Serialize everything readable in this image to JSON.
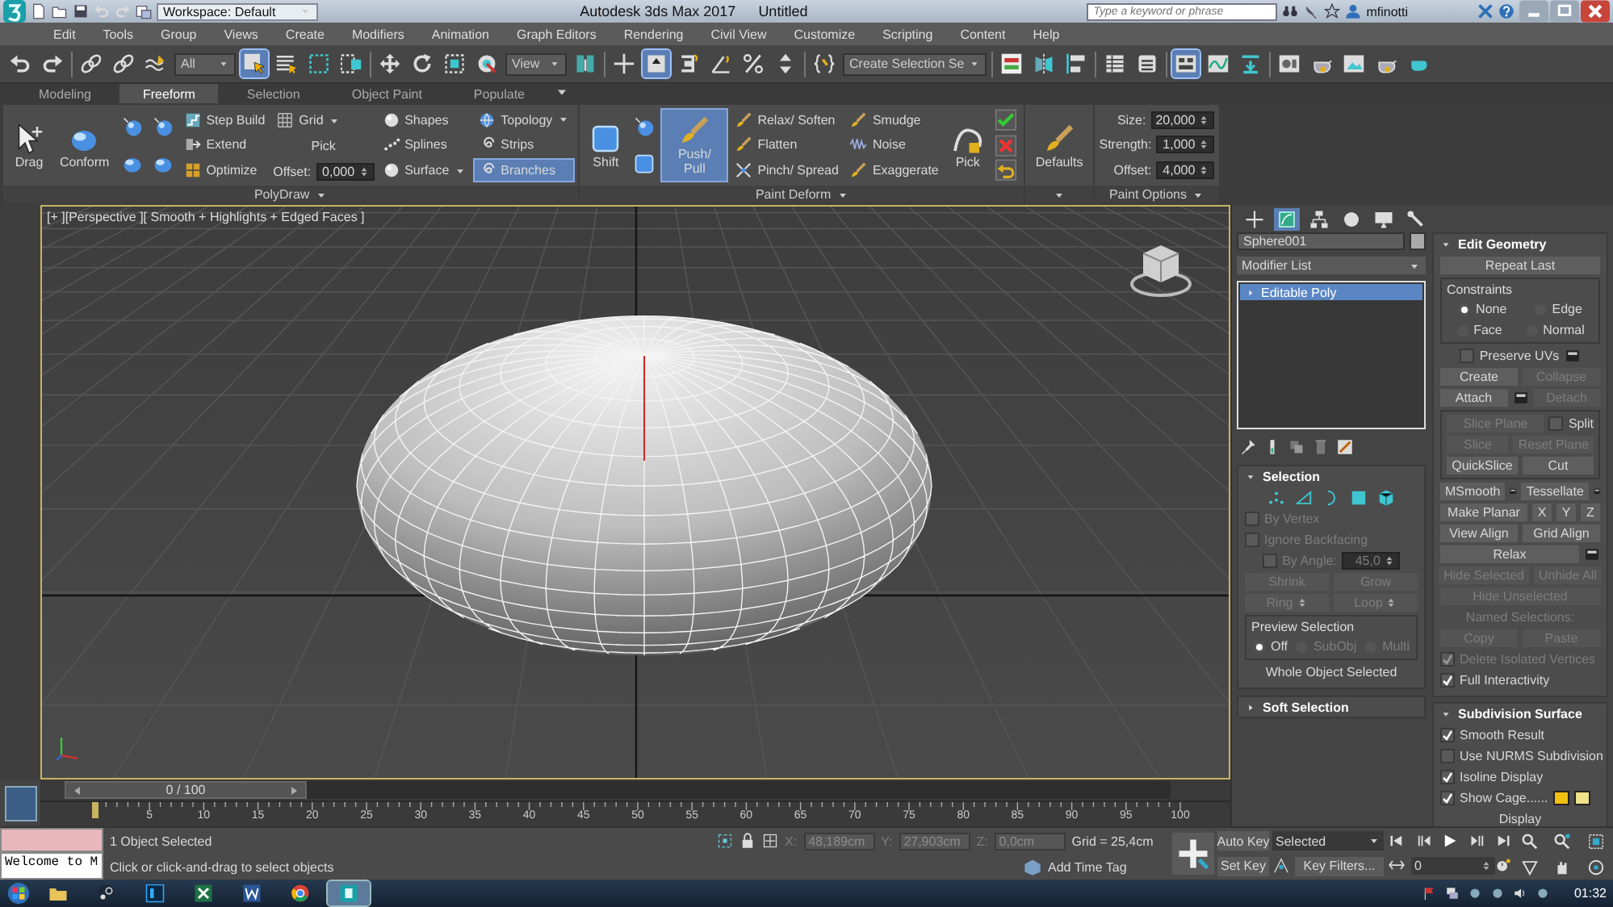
{
  "title_bar": {
    "workspace": "Workspace: Default",
    "title": "Autodesk 3ds Max 2017",
    "document": "Untitled",
    "search": {
      "placeholder": "Type a keyword or phrase"
    },
    "user": "mfinotti"
  },
  "menu": [
    "Edit",
    "Tools",
    "Group",
    "Views",
    "Create",
    "Modifiers",
    "Animation",
    "Graph Editors",
    "Rendering",
    "Civil View",
    "Customize",
    "Scripting",
    "Content",
    "Help"
  ],
  "toolbar": {
    "items": [
      {
        "kind": "button",
        "selected": false
      },
      {
        "kind": "button",
        "selected": false
      },
      {
        "kind": "separator"
      },
      {
        "kind": "button",
        "selected": false
      },
      {
        "kind": "button",
        "selected": false
      },
      {
        "kind": "button",
        "selected": false
      },
      {
        "kind": "dropdown",
        "value": "All"
      },
      {
        "kind": "button",
        "selected": true
      },
      {
        "kind": "button",
        "selected": false
      },
      {
        "kind": "button",
        "selected": false
      },
      {
        "kind": "button",
        "selected": false
      },
      {
        "kind": "separator"
      },
      {
        "kind": "button",
        "selected": false
      },
      {
        "kind": "button",
        "selected": false
      },
      {
        "kind": "button",
        "selected": false
      },
      {
        "kind": "button",
        "selected": false
      },
      {
        "kind": "dropdown",
        "value": "View"
      },
      {
        "kind": "button",
        "selected": false
      },
      {
        "kind": "separator"
      },
      {
        "kind": "button",
        "selected": false
      },
      {
        "kind": "button",
        "selected": true
      },
      {
        "kind": "button",
        "selected": false
      },
      {
        "kind": "button",
        "selected": false
      },
      {
        "kind": "button",
        "selected": false
      },
      {
        "kind": "button",
        "selected": false
      },
      {
        "kind": "separator"
      },
      {
        "kind": "button",
        "selected": false
      },
      {
        "kind": "dropdown",
        "value": "Create Selection Se"
      },
      {
        "kind": "separator"
      },
      {
        "kind": "button",
        "selected": false
      },
      {
        "kind": "button",
        "selected": false
      },
      {
        "kind": "button",
        "selected": false
      },
      {
        "kind": "separator"
      },
      {
        "kind": "button",
        "selected": false
      },
      {
        "kind": "button",
        "selected": false
      },
      {
        "kind": "separator"
      },
      {
        "kind": "button",
        "selected": true
      },
      {
        "kind": "button",
        "selected": false
      },
      {
        "kind": "button",
        "selected": false
      },
      {
        "kind": "separator"
      },
      {
        "kind": "button",
        "selected": false
      },
      {
        "kind": "button",
        "selected": false
      },
      {
        "kind": "button",
        "selected": false
      },
      {
        "kind": "button",
        "selected": false
      },
      {
        "kind": "button",
        "selected": false
      }
    ]
  },
  "ribbon_tabs": [
    {
      "label": "Modeling",
      "selected": false
    },
    {
      "label": "Freeform",
      "selected": true
    },
    {
      "label": "Selection",
      "selected": false
    },
    {
      "label": "Object Paint",
      "selected": false
    },
    {
      "label": "Populate",
      "selected": false
    }
  ],
  "ribbon": {
    "groups": [
      {
        "title": "PolyDraw",
        "columns": [
          [
            {
              "kind": "big",
              "label": "Drag",
              "selected": false
            }
          ],
          [
            {
              "kind": "big",
              "label": "Conform",
              "selected": false
            }
          ],
          [
            {
              "kind": "icon",
              "selected": false
            },
            {
              "kind": "icon",
              "selected": false
            }
          ],
          [
            {
              "kind": "icon",
              "selected": false
            },
            {
              "kind": "icon",
              "selected": false
            }
          ],
          [
            {
              "kind": "small",
              "label": "Step Build",
              "selected": false
            },
            {
              "kind": "small",
              "label": "Extend",
              "selected": false
            },
            {
              "kind": "small",
              "label": "Optimize",
              "selected": false
            }
          ],
          [
            {
              "kind": "dropdown",
              "label": "Grid",
              "selected": false
            },
            {
              "kind": "text",
              "label": "Pick",
              "selected": false
            },
            {
              "kind": "spinner",
              "label": "Offset:",
              "value": "0,000"
            }
          ],
          [
            {
              "kind": "small",
              "label": "Shapes",
              "selected": false
            },
            {
              "kind": "small",
              "label": "Splines",
              "selected": false
            },
            {
              "kind": "small-dropdown",
              "label": "Surface",
              "selected": false
            }
          ],
          [
            {
              "kind": "small-dropdown",
              "label": "Topology",
              "selected": false
            },
            {
              "kind": "small",
              "label": "Strips",
              "selected": false
            },
            {
              "kind": "small",
              "label": "Branches",
              "selected": true
            }
          ]
        ]
      },
      {
        "title": "Paint Deform",
        "columns": [
          [
            {
              "kind": "big",
              "label": "Shift",
              "selected": false
            }
          ],
          [
            {
              "kind": "icon",
              "selected": false
            },
            {
              "kind": "icon",
              "selected": false
            }
          ],
          [
            {
              "kind": "big",
              "label": "Push/ Pull",
              "selected": true
            }
          ],
          [
            {
              "kind": "small",
              "label": "Relax/ Soften",
              "selected": false
            },
            {
              "kind": "small",
              "label": "Flatten",
              "selected": false
            },
            {
              "kind": "small",
              "label": "Pinch/ Spread",
              "selected": false
            }
          ],
          [
            {
              "kind": "small",
              "label": "Smudge",
              "selected": false
            },
            {
              "kind": "small",
              "label": "Noise",
              "selected": false
            },
            {
              "kind": "small",
              "label": "Exaggerate",
              "selected": false
            }
          ],
          [
            {
              "kind": "big",
              "label": "Pick",
              "selected": false
            }
          ],
          [
            {
              "kind": "icon",
              "selected": false
            },
            {
              "kind": "icon",
              "selected": false
            },
            {
              "kind": "icon",
              "selected": false
            }
          ]
        ]
      },
      {
        "columns": [
          [
            {
              "kind": "big",
              "label": "Defaults",
              "selected": false
            }
          ]
        ]
      },
      {
        "title": "Paint Options",
        "columns": [
          [
            {
              "kind": "spinner",
              "label": "Size:",
              "value": "20,000"
            },
            {
              "kind": "spinner",
              "label": "Strength:",
              "value": "1,000"
            },
            {
              "kind": "spinner",
              "label": "Offset:",
              "value": "4,000"
            }
          ]
        ]
      }
    ]
  },
  "viewport": {
    "label": "[+ ][Perspective ][ Smooth + Highlights + Edged Faces ]"
  },
  "command_panel": {
    "tabs": [
      {
        "selected": false
      },
      {
        "selected": true
      },
      {
        "selected": false
      },
      {
        "selected": false
      },
      {
        "selected": false
      },
      {
        "selected": false
      }
    ],
    "object_name": "Sphere001",
    "modifier_list": "Modifier List",
    "stack": [
      {
        "label": "Editable Poly",
        "selected": true
      }
    ],
    "left_rollouts": [
      {
        "title": "Selection",
        "expanded": true,
        "content": [
          {
            "kind": "row",
            "items": [
              {
                "kind": "icon",
                "selected": false
              },
              {
                "kind": "icon",
                "selected": false
              },
              {
                "kind": "icon",
                "selected": false
              },
              {
                "kind": "icon",
                "selected": false
              },
              {
                "kind": "icon",
                "selected": false
              }
            ]
          },
          {
            "kind": "row",
            "items": [
              {
                "kind": "check",
                "label": "By Vertex",
                "checked": false,
                "disabled": true
              }
            ]
          },
          {
            "kind": "row",
            "items": [
              {
                "kind": "check",
                "label": "Ignore Backfacing",
                "checked": false,
                "disabled": true
              }
            ]
          },
          {
            "kind": "row",
            "items": [
              {
                "kind": "check",
                "label": "By Angle:",
                "checked": false,
                "disabled": true
              },
              {
                "kind": "spinner",
                "value": "45,0",
                "disabled": true
              }
            ]
          },
          {
            "kind": "row",
            "items": [
              {
                "kind": "button",
                "label": "Shrink",
                "disabled": true
              },
              {
                "kind": "button",
                "label": "Grow",
                "disabled": true
              }
            ]
          },
          {
            "kind": "row",
            "items": [
              {
                "kind": "button",
                "label": "Ring",
                "disabled": true,
                "spinner": true
              },
              {
                "kind": "button",
                "label": "Loop",
                "disabled": true,
                "spinner": true
              }
            ]
          },
          {
            "kind": "box",
            "title": "Preview Selection",
            "rows": [
              {
                "kind": "row",
                "items": [
                  {
                    "kind": "radio",
                    "label": "Off",
                    "selected": true,
                    "disabled": false
                  },
                  {
                    "kind": "radio",
                    "label": "SubObj",
                    "selected": false,
                    "disabled": true
                  },
                  {
                    "kind": "radio",
                    "label": "Multi",
                    "selected": false,
                    "disabled": true
                  }
                ]
              }
            ]
          },
          {
            "kind": "row",
            "items": [
              {
                "kind": "label",
                "label": "Whole Object Selected",
                "disabled": false
              }
            ]
          }
        ]
      },
      {
        "title": "Soft Selection",
        "expanded": false
      }
    ],
    "right_rollouts": [
      {
        "title": "Edit Geometry",
        "expanded": true,
        "content": [
          {
            "kind": "row",
            "items": [
              {
                "kind": "button",
                "label": "Repeat Last",
                "disabled": false
              }
            ]
          },
          {
            "kind": "box",
            "title": "Constraints",
            "rows": [
              {
                "kind": "row",
                "items": [
                  {
                    "kind": "radio",
                    "label": "None",
                    "selected": true,
                    "disabled": false
                  },
                  {
                    "kind": "radio",
                    "label": "Edge",
                    "selected": false,
                    "disabled": false
                  }
                ]
              },
              {
                "kind": "row",
                "items": [
                  {
                    "kind": "radio",
                    "label": "Face",
                    "selected": false,
                    "disabled": false
                  },
                  {
                    "kind": "radio",
                    "label": "Normal",
                    "selected": false,
                    "disabled": false
                  }
                ]
              }
            ]
          },
          {
            "kind": "row",
            "items": [
              {
                "kind": "check",
                "label": "Preserve UVs",
                "checked": false,
                "disabled": false
              },
              {
                "kind": "settings",
                "disabled": false
              }
            ]
          },
          {
            "kind": "row",
            "items": [
              {
                "kind": "button",
                "label": "Create",
                "disabled": false
              },
              {
                "kind": "button",
                "label": "Collapse",
                "disabled": true
              }
            ]
          },
          {
            "kind": "row",
            "items": [
              {
                "kind": "button",
                "label": "Attach",
                "disabled": false
              },
              {
                "kind": "settings",
                "disabled": false
              },
              {
                "kind": "button",
                "label": "Detach",
                "disabled": true
              }
            ]
          },
          {
            "kind": "box",
            "rows": [
              {
                "kind": "row",
                "items": [
                  {
                    "kind": "button",
                    "label": "Slice Plane",
                    "disabled": true
                  },
                  {
                    "kind": "check",
                    "label": "Split",
                    "checked": false,
                    "disabled": false
                  }
                ]
              },
              {
                "kind": "row",
                "items": [
                  {
                    "kind": "button",
                    "label": "Slice",
                    "disabled": true
                  },
                  {
                    "kind": "button",
                    "label": "Reset Plane",
                    "disabled": true
                  }
                ]
              },
              {
                "kind": "row",
                "items": [
                  {
                    "kind": "button",
                    "label": "QuickSlice",
                    "disabled": false
                  },
                  {
                    "kind": "button",
                    "label": "Cut",
                    "disabled": false
                  }
                ]
              }
            ]
          },
          {
            "kind": "row",
            "items": [
              {
                "kind": "button",
                "label": "MSmooth",
                "disabled": false
              },
              {
                "kind": "settings",
                "disabled": false
              },
              {
                "kind": "button",
                "label": "Tessellate",
                "disabled": false
              },
              {
                "kind": "settings",
                "disabled": false
              }
            ]
          },
          {
            "kind": "row",
            "items": [
              {
                "kind": "button",
                "label": "Make Planar",
                "disabled": false
              },
              {
                "kind": "button",
                "label": "X",
                "disabled": false
              },
              {
                "kind": "button",
                "label": "Y",
                "disabled": false
              },
              {
                "kind": "button",
                "label": "Z",
                "disabled": false
              }
            ]
          },
          {
            "kind": "row",
            "items": [
              {
                "kind": "button",
                "label": "View Align",
                "disabled": false
              },
              {
                "kind": "button",
                "label": "Grid Align",
                "disabled": false
              }
            ]
          },
          {
            "kind": "row",
            "items": [
              {
                "kind": "button",
                "label": "Relax",
                "disabled": false
              },
              {
                "kind": "settings",
                "disabled": false
              }
            ]
          },
          {
            "kind": "row",
            "items": [
              {
                "kind": "button",
                "label": "Hide Selected",
                "disabled": true
              },
              {
                "kind": "button",
                "label": "Unhide All",
                "disabled": true
              }
            ]
          },
          {
            "kind": "row",
            "items": [
              {
                "kind": "button",
                "label": "Hide Unselected",
                "disabled": true
              }
            ]
          },
          {
            "kind": "row",
            "items": [
              {
                "kind": "label",
                "label": "Named Selections:",
                "disabled": true
              }
            ]
          },
          {
            "kind": "row",
            "items": [
              {
                "kind": "button",
                "label": "Copy",
                "disabled": true
              },
              {
                "kind": "button",
                "label": "Paste",
                "disabled": true
              }
            ]
          },
          {
            "kind": "row",
            "items": [
              {
                "kind": "check",
                "label": "Delete Isolated Vertices",
                "checked": true,
                "disabled": true
              }
            ]
          },
          {
            "kind": "row",
            "items": [
              {
                "kind": "check",
                "label": "Full Interactivity",
                "checked": true,
                "disabled": false
              }
            ]
          }
        ]
      },
      {
        "title": "Subdivision Surface",
        "expanded": true,
        "content": [
          {
            "kind": "row",
            "items": [
              {
                "kind": "check",
                "label": "Smooth Result",
                "checked": true,
                "disabled": false
              }
            ]
          },
          {
            "kind": "row",
            "items": [
              {
                "kind": "check",
                "label": "Use NURMS Subdivision",
                "checked": false,
                "disabled": false
              }
            ]
          },
          {
            "kind": "row",
            "items": [
              {
                "kind": "check",
                "label": "Isoline Display",
                "checked": true,
                "disabled": false
              }
            ]
          },
          {
            "kind": "row",
            "items": [
              {
                "kind": "check",
                "label": "Show Cage......",
                "checked": true,
                "disabled": false
              },
              {
                "kind": "swatch",
                "color": "#f2c10f"
              },
              {
                "kind": "swatch",
                "color": "#eee28a"
              }
            ]
          },
          {
            "kind": "row",
            "items": [
              {
                "kind": "label",
                "label": "Display",
                "disabled": false
              }
            ]
          }
        ]
      }
    ]
  },
  "time_slider": {
    "label": "0 / 100"
  },
  "track_bar": {
    "ticks": [
      "5",
      "10",
      "15",
      "20",
      "25",
      "30",
      "35",
      "40",
      "45",
      "50",
      "55",
      "60",
      "65",
      "70",
      "75",
      "80",
      "85",
      "90",
      "95",
      "100"
    ]
  },
  "status_bar": {
    "listener": "Welcome to M",
    "selection": "1 Object Selected",
    "prompt": "Click or click-and-drag to select objects",
    "coords": [
      {
        "axis": "X:",
        "value": "48,189cm"
      },
      {
        "axis": "Y:",
        "value": "27,903cm"
      },
      {
        "axis": "Z:",
        "value": "0,0cm"
      }
    ],
    "grid": "Grid = 25,4cm",
    "time_tag": "Add Time Tag",
    "auto_key": "Auto Key",
    "key_mode": "Selected",
    "set_key": "Set Key",
    "key_filters": "Key Filters...",
    "frame": "0"
  },
  "taskbar": {
    "apps": [
      {
        "selected": false
      },
      {
        "selected": false
      },
      {
        "selected": false
      },
      {
        "selected": false
      },
      {
        "selected": false
      },
      {
        "selected": false
      },
      {
        "selected": true
      }
    ],
    "clock": "01:32"
  }
}
